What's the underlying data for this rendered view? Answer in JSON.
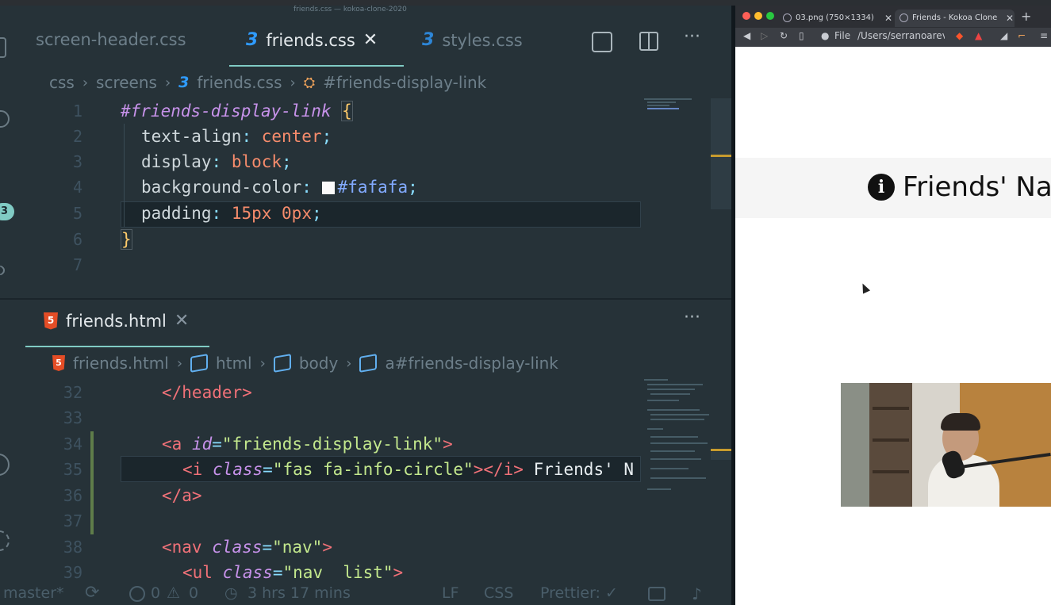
{
  "window_title": "friends.css — kokoa-clone-2020",
  "editor": {
    "top_tabs": [
      {
        "label": "screen-header.css"
      },
      {
        "label": "friends.css",
        "close": "✕"
      },
      {
        "label": "styles.css"
      }
    ],
    "css_breadcrumb": [
      "css",
      "screens",
      "friends.css",
      "#friends-display-link"
    ],
    "badge_count": "3",
    "css_lines": [
      {
        "n": "1"
      },
      {
        "n": "2"
      },
      {
        "n": "3"
      },
      {
        "n": "4"
      },
      {
        "n": "5"
      },
      {
        "n": "6"
      },
      {
        "n": "7"
      }
    ],
    "css_code": {
      "l1_sel": "#friends-display-link",
      "l1_brace": "{",
      "l2_prop": "text-align",
      "l2_val": "center",
      "l3_prop": "display",
      "l3_val": "block",
      "l4_prop": "background-color",
      "l4_val": "#fafafa",
      "l5_prop": "padding",
      "l5_val": "15px 0px",
      "l6_brace": "}"
    },
    "html_tab": {
      "label": "friends.html",
      "close": "✕"
    },
    "html_breadcrumb": [
      "friends.html",
      "html",
      "body",
      "a#friends-display-link"
    ],
    "html_lines": [
      {
        "n": "32"
      },
      {
        "n": "33"
      },
      {
        "n": "34"
      },
      {
        "n": "35"
      },
      {
        "n": "36"
      },
      {
        "n": "37"
      },
      {
        "n": "38"
      },
      {
        "n": "39"
      }
    ],
    "html_code": {
      "l32": "</header>",
      "l34_open": "<a",
      "l34_attr": "id",
      "l34_val": "\"friends-display-link\"",
      "l34_close": ">",
      "l35_open": "<i",
      "l35_attr": "class",
      "l35_val": "\"fas fa-info-circle\"",
      "l35_mid": "></",
      "l35_tag": "i",
      "l35_gt": ">",
      "l35_text": " Friends' N",
      "l36": "</a>",
      "l38_open": "<nav",
      "l38_attr": "class",
      "l38_val": "\"nav\"",
      "l38_close": ">",
      "l39_open": "<ul",
      "l39_attr": "class",
      "l39_val": "\"nav  list\"",
      "l39_close": ">"
    },
    "more": "···"
  },
  "status_bar": {
    "branch": "master*",
    "errors": "0",
    "warnings": "0",
    "time": "3 hrs 17 mins",
    "eol": "LF",
    "language": "CSS",
    "formatter": "Prettier: ✓"
  },
  "browser": {
    "tabs": [
      {
        "label": "03.png (750×1334)"
      },
      {
        "label": "Friends - Kokoa Clone"
      }
    ],
    "new_tab": "+",
    "address_scheme": "File",
    "address": "/Users/serranoareval...",
    "page_heading": "Friends' Nar",
    "info_glyph": "i"
  },
  "colors": {
    "editor_bg": "#263238",
    "accent": "#80cbc4",
    "css_icon": "#2f9bff",
    "html_icon": "#e44d26",
    "page_bar": "#f5f5f5"
  }
}
